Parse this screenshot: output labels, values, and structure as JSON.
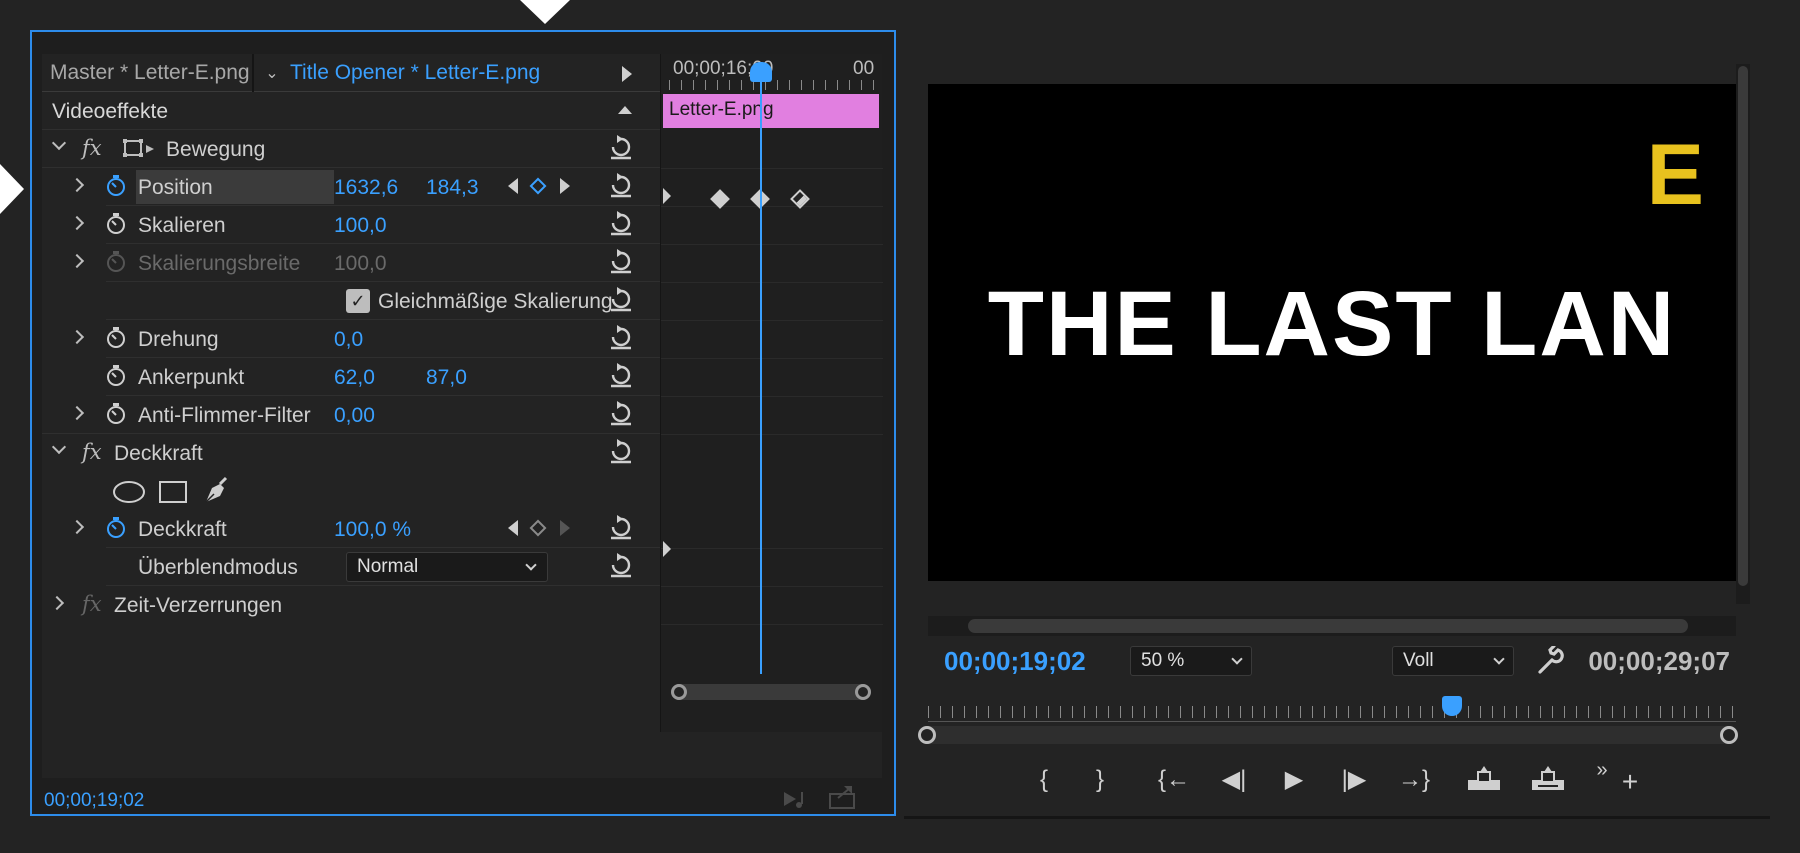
{
  "effect_controls": {
    "tabs": {
      "master": "Master * Letter-E.png",
      "active": "Title Opener * Letter-E.png"
    },
    "sections": {
      "video_effects_header": "Videoeffekte",
      "motion": "Bewegung",
      "opacity": "Deckkraft",
      "time_remap": "Zeit-Verzerrungen"
    },
    "properties": {
      "position": {
        "label": "Position",
        "x": "1632,6",
        "y": "184,3"
      },
      "scale": {
        "label": "Skalieren",
        "value": "100,0"
      },
      "scale_width": {
        "label": "Skalierungsbreite",
        "value": "100,0"
      },
      "uniform_scale": {
        "label": "Gleichmäßige Skalierung",
        "checked": true
      },
      "rotation": {
        "label": "Drehung",
        "value": "0,0"
      },
      "anchor": {
        "label": "Ankerpunkt",
        "x": "62,0",
        "y": "87,0"
      },
      "anti_flicker": {
        "label": "Anti-Flimmer-Filter",
        "value": "0,00"
      },
      "opacity": {
        "label": "Deckkraft",
        "value": "100,0 %"
      },
      "blend_mode": {
        "label": "Überblendmodus",
        "value": "Normal"
      }
    },
    "timeline": {
      "time_start": "00;00;16;00",
      "time_end": "00",
      "clip_name": "Letter-E.png"
    },
    "footer_timecode": "00;00;19;02"
  },
  "program_monitor": {
    "video_title": "THE LAST LAN",
    "video_letter": "E",
    "current_time": "00;00;19;02",
    "zoom": "50 %",
    "resolution": "Voll",
    "duration": "00;00;29;07"
  },
  "colors": {
    "accent": "#3aa0ff",
    "clip": "#e17fe0",
    "letter": "#e8c21e",
    "panel_border": "#2d8ceb"
  },
  "icons": [
    "stopwatch-icon",
    "reset-icon",
    "fx-icon",
    "motion-transform-icon",
    "ellipse-mask-icon",
    "rectangle-mask-icon",
    "pen-mask-icon",
    "wrench-icon"
  ]
}
